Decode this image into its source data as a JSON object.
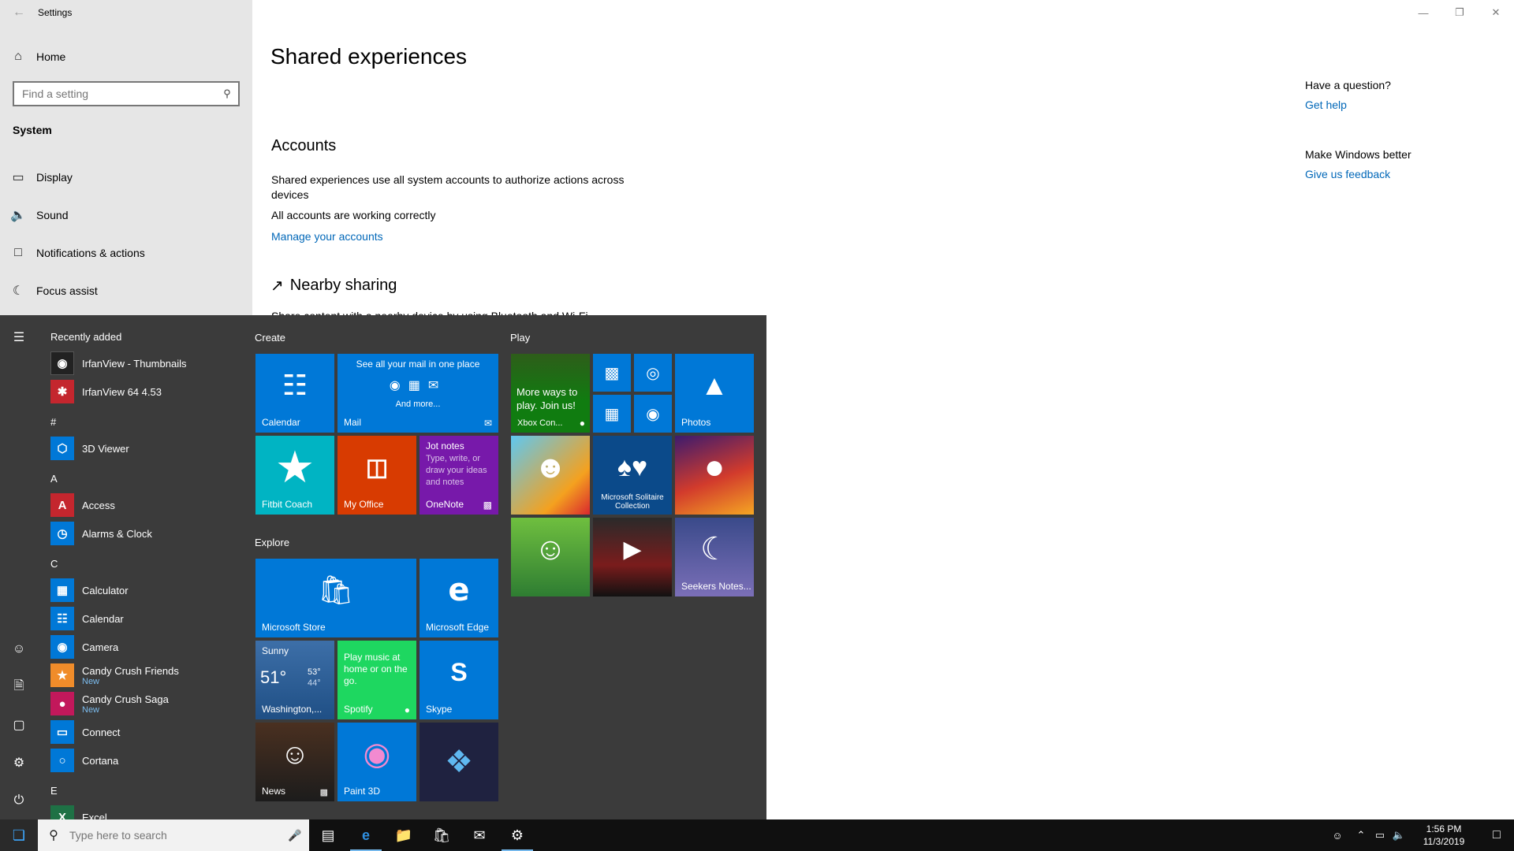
{
  "settings": {
    "title": "Settings",
    "back_icon": "back-arrow-icon",
    "home_label": "Home",
    "search_placeholder": "Find a setting",
    "section_label": "System",
    "nav": [
      {
        "label": "Display",
        "icon": "monitor-icon"
      },
      {
        "label": "Sound",
        "icon": "speaker-icon"
      },
      {
        "label": "Notifications & actions",
        "icon": "message-icon"
      },
      {
        "label": "Focus assist",
        "icon": "moon-icon"
      }
    ],
    "page_title": "Shared experiences",
    "accounts": {
      "title": "Accounts",
      "desc": "Shared experiences use all system accounts to authorize actions across devices",
      "status": "All accounts are working correctly",
      "link": "Manage your accounts"
    },
    "nearby": {
      "title": "Nearby sharing",
      "desc_partial": "Share content with a nearby device by using Bluetooth and Wi-Fi"
    },
    "help": {
      "question": "Have a question?",
      "help_link": "Get help",
      "better": "Make Windows better",
      "feedback_link": "Give us feedback"
    }
  },
  "start_menu": {
    "recent_header": "Recently added",
    "apps": [
      {
        "name": "IrfanView - Thumbnails"
      },
      {
        "name": "IrfanView 64 4.53"
      },
      {
        "group": "#"
      },
      {
        "name": "3D Viewer"
      },
      {
        "group": "A"
      },
      {
        "name": "Access"
      },
      {
        "name": "Alarms & Clock"
      },
      {
        "group": "C"
      },
      {
        "name": "Calculator"
      },
      {
        "name": "Calendar"
      },
      {
        "name": "Camera"
      },
      {
        "name": "Candy Crush Friends",
        "sub": "New"
      },
      {
        "name": "Candy Crush Saga",
        "sub": "New"
      },
      {
        "name": "Connect"
      },
      {
        "name": "Cortana"
      },
      {
        "group": "E"
      },
      {
        "name": "Excel"
      }
    ],
    "groups": {
      "create": "Create",
      "play": "Play",
      "explore": "Explore"
    },
    "tiles": {
      "calendar": "Calendar",
      "mail": "Mail",
      "mail_header": "See all your mail in one place",
      "mail_more": "And more...",
      "fitbit": "Fitbit Coach",
      "myoffice": "My Office",
      "onenote": "OneNote",
      "onenote_title": "Jot notes",
      "onenote_desc": "Type, write, or draw your ideas and notes",
      "xbox_promo": "More ways to play. Join us!",
      "xbox": "Xbox Con...",
      "photos": "Photos",
      "solitaire": "Microsoft Solitaire Collection",
      "seekers": "Seekers Notes...",
      "store": "Microsoft Store",
      "edge": "Microsoft Edge",
      "weather_cond": "Sunny",
      "weather_temp": "51°",
      "weather_hi": "53°",
      "weather_lo": "44°",
      "weather_loc": "Washington,...",
      "spotify_promo": "Play music at home or on the go.",
      "spotify": "Spotify",
      "skype": "Skype",
      "news": "News",
      "paint3d": "Paint 3D"
    }
  },
  "taskbar": {
    "search_placeholder": "Type here to search",
    "time": "1:56 PM",
    "date": "11/3/2019"
  },
  "colors": {
    "accent": "#0078d7",
    "start_bg": "#3b3b3b",
    "link": "#0067b8"
  }
}
